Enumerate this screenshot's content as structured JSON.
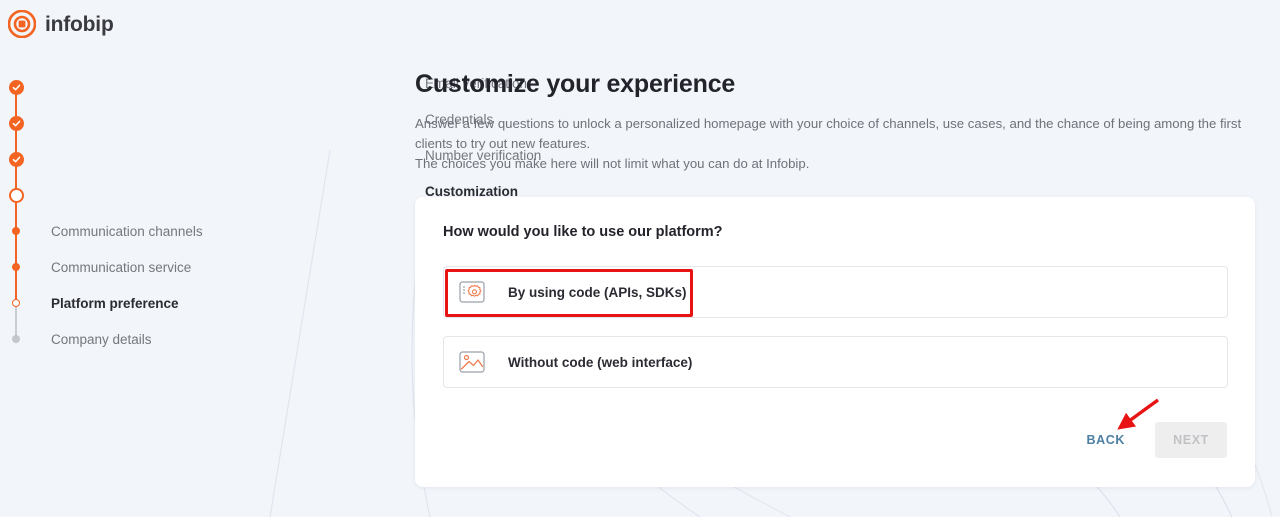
{
  "brand": {
    "name": "infobip",
    "logo_icon": "infobip-target-logo",
    "accent_color": "#f36423",
    "annotation_color": "#e81414"
  },
  "stepper": {
    "steps": [
      {
        "label": "Email verification",
        "state": "done",
        "level": "main"
      },
      {
        "label": "Credentials",
        "state": "done",
        "level": "main"
      },
      {
        "label": "Number verification",
        "state": "done",
        "level": "main"
      },
      {
        "label": "Customization",
        "state": "current",
        "level": "main"
      },
      {
        "label": "Communication channels",
        "state": "sub-done",
        "level": "sub"
      },
      {
        "label": "Communication service",
        "state": "sub-done",
        "level": "sub"
      },
      {
        "label": "Platform preference",
        "state": "sub-current",
        "level": "sub"
      },
      {
        "label": "Company details",
        "state": "future",
        "level": "sub"
      }
    ]
  },
  "main": {
    "title": "Customize your experience",
    "description_line1": "Answer a few questions to unlock a personalized homepage with your choice of channels, use cases, and the chance of being among the first",
    "description_line2": "clients to try out new features.",
    "description_line3": "The choices you make here will not limit what you can do at Infobip."
  },
  "card": {
    "question": "How would you like to use our platform?",
    "options": [
      {
        "label": "By using code (APIs, SDKs)",
        "icon": "code-window-gear-icon",
        "selected": false,
        "highlighted": true
      },
      {
        "label": "Without code (web interface)",
        "icon": "image-picture-icon",
        "selected": false,
        "highlighted": false
      }
    ],
    "actions": {
      "back_label": "BACK",
      "next_label": "NEXT",
      "next_disabled": true
    }
  }
}
